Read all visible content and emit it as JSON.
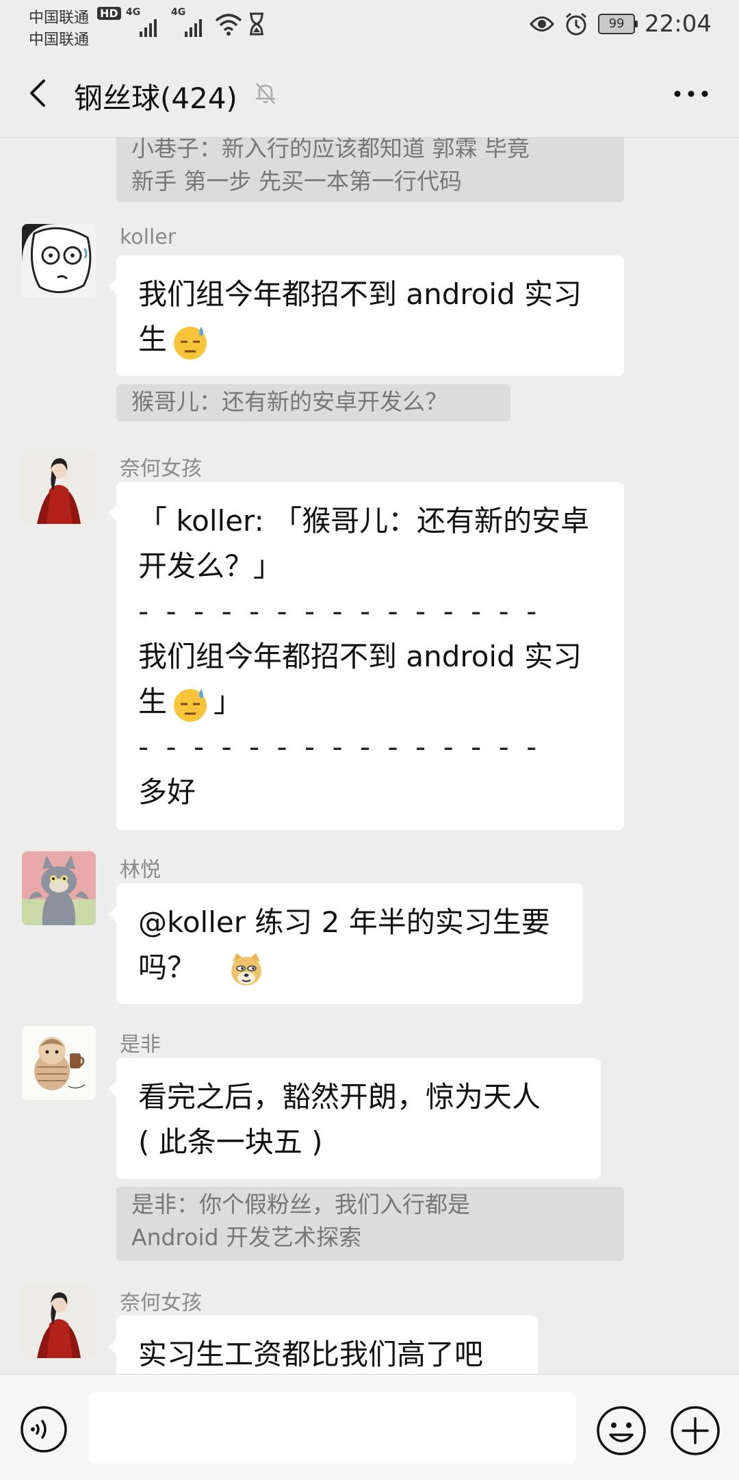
{
  "status_bar": {
    "carrier1": "中国联通",
    "carrier2": "中国联通",
    "hd_badge": "HD",
    "signal1_label": "4G",
    "signal2_label": "4G",
    "battery": "99",
    "time": "22:04"
  },
  "nav": {
    "title": "钢丝球(424)"
  },
  "messages": {
    "q1": {
      "line1": "小巷子：新入行的应该都知道 郭霖 毕竟",
      "line2": "新手 第一步 先买一本第一行代码"
    },
    "m1": {
      "sender": "koller",
      "line1": "我们组今年都招不到 android 实习",
      "line2": "生"
    },
    "q2": {
      "text": "猴哥儿：还有新的安卓开发么？"
    },
    "m2": {
      "sender": "奈何女孩",
      "line1": "「 koller: 「猴哥儿：还有新的安卓",
      "line2": "开发么？」",
      "sep1": "- - - - - - - - - - - - - - -",
      "line3": "我们组今年都招不到 android 实习",
      "line4_text": "生",
      "line4_end": "」",
      "sep2": "- - - - - - - - - - - - - - -",
      "line5": "多好"
    },
    "m3": {
      "sender": "林悦",
      "line1": "@koller 练习 2 年半的实习生要",
      "line2": "吗？"
    },
    "m4": {
      "sender": "是非",
      "line1": "看完之后，豁然开朗，惊为天人",
      "line2": "( 此条一块五 )"
    },
    "q3": {
      "line1": "是非：你个假粉丝，我们入行都是",
      "line2": "Android 开发艺术探索"
    },
    "m5": {
      "sender": "奈何女孩",
      "line1": "实习生工资都比我们高了吧"
    }
  },
  "input": {
    "value": ""
  },
  "icons": {
    "back": "back-arrow-icon",
    "mute": "mute-bell-icon",
    "more": "more-dots-icon",
    "voice": "voice-icon",
    "emoji": "emoji-icon",
    "plus": "plus-icon"
  }
}
